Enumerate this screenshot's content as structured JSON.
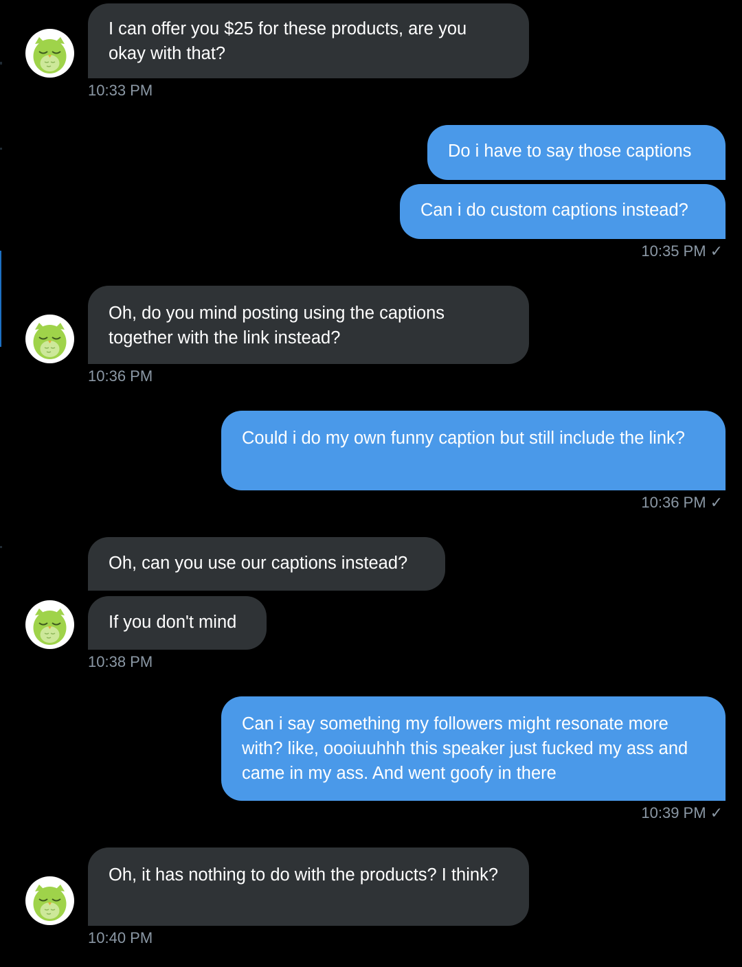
{
  "conversation": {
    "messages": [
      {
        "sender": "them",
        "text": "I can offer you $25 for these products, are you okay with that?"
      },
      {
        "sender": "me",
        "text": "Do i have to say those captions"
      },
      {
        "sender": "me",
        "text": "Can i do custom captions instead?"
      },
      {
        "sender": "them",
        "text": "Oh, do you mind posting using the captions together with the link instead?"
      },
      {
        "sender": "me",
        "text": "Could i do my own funny caption but still include the link?"
      },
      {
        "sender": "them",
        "text": "Oh, can you use our captions instead?"
      },
      {
        "sender": "them",
        "text": "If you don't mind"
      },
      {
        "sender": "me",
        "text": "Can i say something my followers might resonate more with? like, oooiuuhhh this speaker just fucked my ass and came in my ass. And went goofy in there"
      },
      {
        "sender": "them",
        "text": "Oh, it has nothing to do with the products? I think?"
      }
    ],
    "timestamps": [
      "10:33 PM",
      "10:35 PM",
      "10:36 PM",
      "10:36 PM",
      "10:38 PM",
      "10:39 PM",
      "10:40 PM"
    ],
    "read_mark": "✓"
  },
  "avatar": {
    "icon": "owl-avatar-icon"
  },
  "colors": {
    "background": "#000000",
    "incoming_bubble": "#2f3336",
    "outgoing_bubble": "#4a99e9",
    "timestamp": "#8b98a5",
    "avatar_green": "#9fd34a"
  }
}
